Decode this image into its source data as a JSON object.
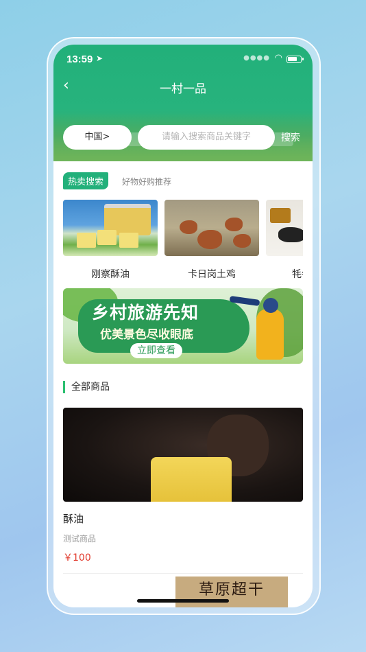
{
  "status_bar": {
    "time": "13:59",
    "location_icon": "location-arrow-icon",
    "wifi_icon": "wifi-icon",
    "battery_icon": "battery-icon"
  },
  "nav": {
    "back_icon": "chevron-left-icon",
    "title": "一村一品"
  },
  "search": {
    "region": "中国>",
    "placeholder": "请输入搜索商品关键字",
    "button": "搜索"
  },
  "hot": {
    "tag": "热卖搜索",
    "subtitle": "好物好购推荐",
    "items": [
      {
        "label": "刚察酥油"
      },
      {
        "label": "卡日岗土鸡"
      },
      {
        "label": "牦牛"
      }
    ]
  },
  "banner": {
    "title": "乡村旅游先知",
    "subtitle": "优美景色尽收眼底",
    "cta": "立即查看"
  },
  "all_products": {
    "title": "全部商品",
    "items": [
      {
        "name": "酥油",
        "desc": "测试商品",
        "price": "￥100"
      },
      {
        "image_text": "草原超干"
      }
    ]
  },
  "colors": {
    "accent": "#22b07a",
    "price": "#e23b2e"
  }
}
